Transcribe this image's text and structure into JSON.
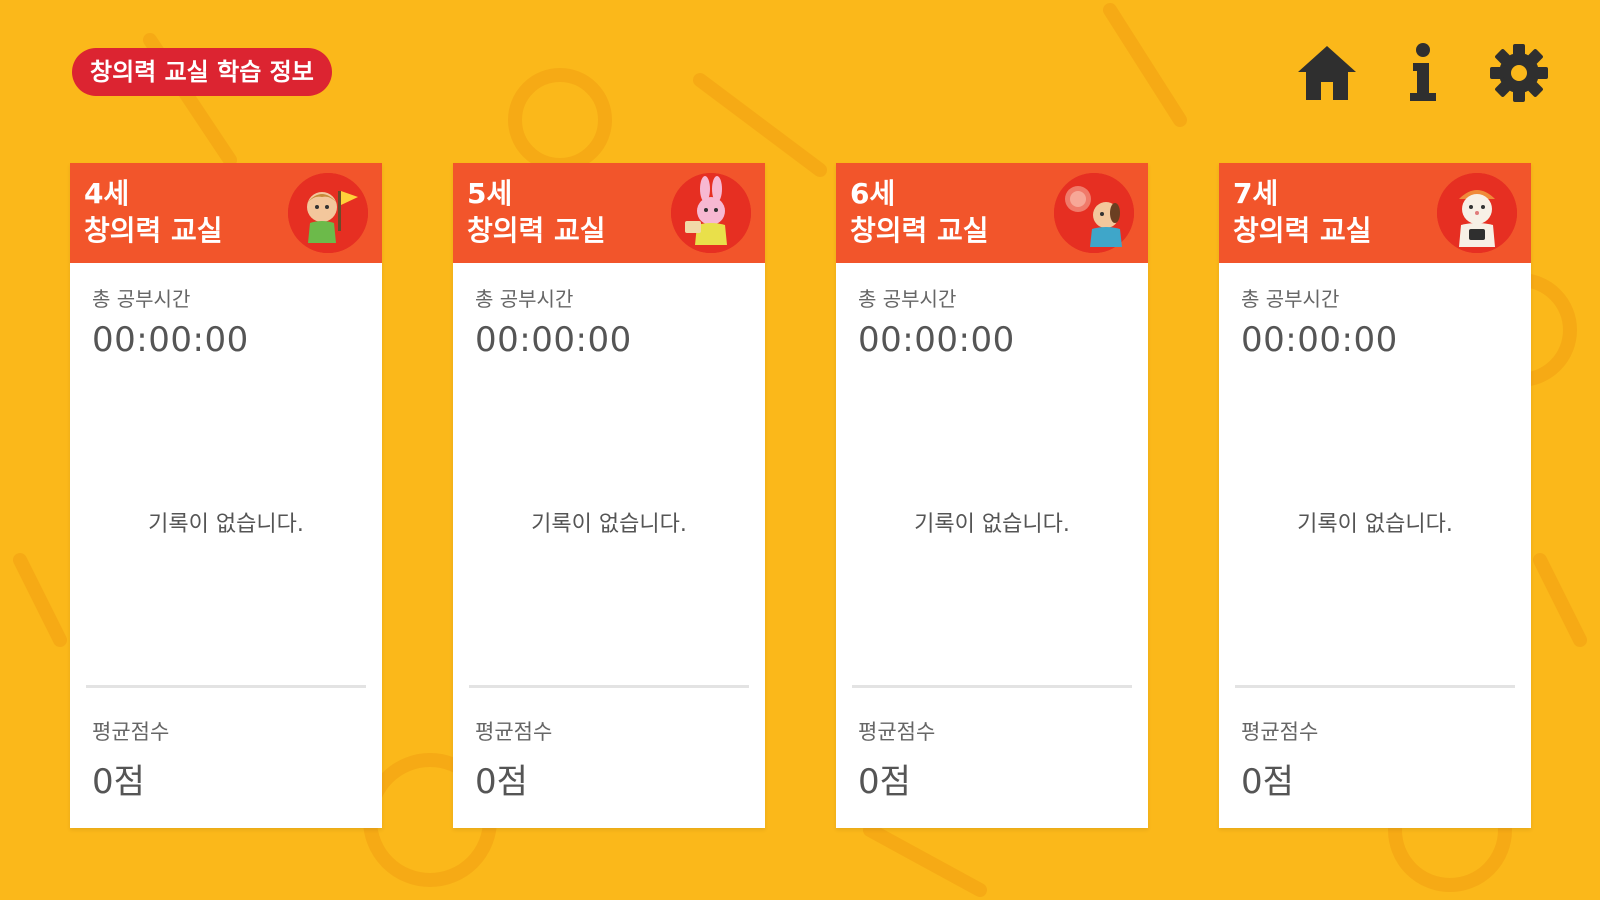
{
  "header": {
    "title": "창의력 교실 학습 정보",
    "title_color": "#dc2431",
    "icons": [
      {
        "name": "home-icon"
      },
      {
        "name": "info-icon"
      },
      {
        "name": "gear-icon"
      }
    ]
  },
  "theme": {
    "background": "#fbb81a",
    "card_header": "#f2552b",
    "icon_color": "#2f2f2f"
  },
  "cards": [
    {
      "age": "4세",
      "title": "창의력 교실",
      "avatar": "boy-with-flag-avatar",
      "study_label": "총 공부시간",
      "study_time": "00:00:00",
      "empty_message": "기록이 없습니다.",
      "score_label": "평균점수",
      "score": "0점"
    },
    {
      "age": "5세",
      "title": "창의력 교실",
      "avatar": "bunny-avatar",
      "study_label": "총 공부시간",
      "study_time": "00:00:00",
      "empty_message": "기록이 없습니다.",
      "score_label": "평균점수",
      "score": "0점"
    },
    {
      "age": "6세",
      "title": "창의력 교실",
      "avatar": "dog-with-bubble-avatar",
      "study_label": "총 공부시간",
      "study_time": "00:00:00",
      "empty_message": "기록이 없습니다.",
      "score_label": "평균점수",
      "score": "0점"
    },
    {
      "age": "7세",
      "title": "창의력 교실",
      "avatar": "hamster-avatar",
      "study_label": "총 공부시간",
      "study_time": "00:00:00",
      "empty_message": "기록이 없습니다.",
      "score_label": "평균점수",
      "score": "0점"
    }
  ]
}
